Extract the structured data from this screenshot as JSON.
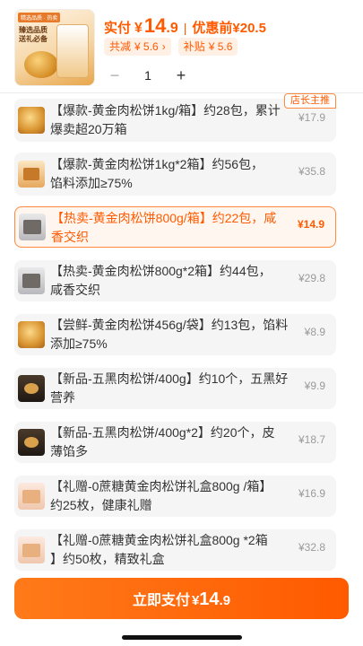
{
  "header": {
    "thumb_tag": "精选品质 · 热卖",
    "thumb_slogan": "臻选品质 送礼必备",
    "pay_label": "实付",
    "currency": "¥",
    "pay_int": "14",
    "pay_dec": ".9",
    "separator": "|",
    "orig_label": "优惠前",
    "orig_price": "¥20.5",
    "chips": [
      {
        "label": "共减",
        "value": "¥ 5.6",
        "arrow": "›"
      },
      {
        "label": "补贴",
        "value": "¥ 5.6"
      }
    ],
    "quantity": "1",
    "minus": "−",
    "plus": "+"
  },
  "badge": "店长主推",
  "items": [
    {
      "line1": "【爆款-黄金肉松饼1kg/箱】约28包，累计",
      "line2": "爆卖超20万箱",
      "price": "¥17.9",
      "thumb": "cake",
      "selected": false
    },
    {
      "line1": "【爆款-黄金肉松饼1kg*2箱】约56包，",
      "line2": "馅料添加≥75%",
      "price": "¥35.8",
      "thumb": "box",
      "selected": false
    },
    {
      "line1": "【热卖-黄金肉松饼800g/箱】约22包，咸",
      "line2": "香交织",
      "price": "¥14.9",
      "thumb": "gray",
      "selected": true
    },
    {
      "line1": "【热卖-黄金肉松饼800g*2箱】约44包，",
      "line2": "咸香交织",
      "price": "¥29.8",
      "thumb": "gray",
      "selected": false
    },
    {
      "line1": "【尝鲜-黄金肉松饼456g/袋】约13包，馅料",
      "line2": "添加≥75%",
      "price": "¥8.9",
      "thumb": "cake",
      "selected": false
    },
    {
      "line1": "【新品-五黑肉松饼/400g】约10个，五黑好",
      "line2": "营养",
      "price": "¥9.9",
      "thumb": "dark",
      "selected": false
    },
    {
      "line1": "【新品-五黑肉松饼/400g*2】约20个，皮",
      "line2": "薄馅多",
      "price": "¥18.7",
      "thumb": "dark",
      "selected": false
    },
    {
      "line1": "【礼赠-0蔗糖黄金肉松饼礼盒800g /箱】",
      "line2": "约25枚，健康礼赠",
      "price": "¥16.9",
      "thumb": "pink",
      "selected": false
    },
    {
      "line1": "【礼赠-0蔗糖黄金肉松饼礼盒800g *2箱",
      "line2": "】约50枚，精致礼盒",
      "price": "¥32.8",
      "thumb": "pink",
      "selected": false
    }
  ],
  "pay_button": {
    "label": "立即支付",
    "currency": "¥",
    "int": "14",
    "dec": ".9"
  },
  "colors": {
    "accent": "#ff5a00",
    "selected_bg": "#fff6ef",
    "item_bg": "#f5f5f5",
    "price_gray": "#9a9a9a"
  }
}
